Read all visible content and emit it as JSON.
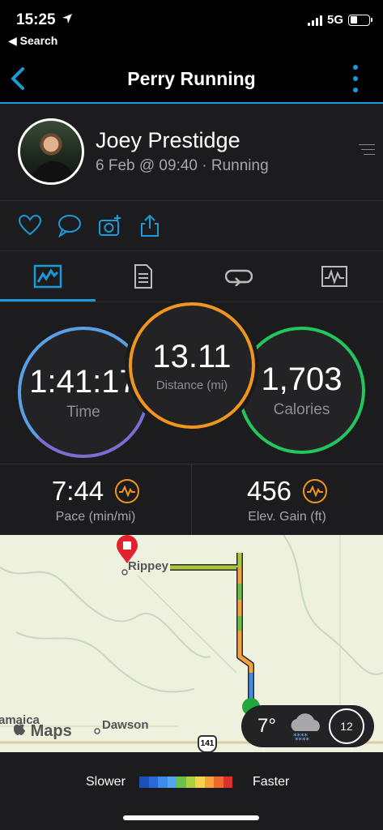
{
  "status_bar": {
    "time": "15:25",
    "back_label": "◀ Search",
    "network": "5G"
  },
  "nav": {
    "title": "Perry Running"
  },
  "header": {
    "user_name": "Joey Prestidge",
    "meta": "6 Feb @ 09:40 · Running"
  },
  "actions": [
    "heart-icon",
    "comment-icon",
    "add-photo-icon",
    "share-icon"
  ],
  "tabs": [
    "stats-tab",
    "details-tab",
    "laps-tab",
    "charts-tab"
  ],
  "stats": {
    "time": {
      "value": "1:41:17",
      "label": "Time",
      "color": "#7a6fd0"
    },
    "distance": {
      "value": "13.11",
      "label": "Distance (mi)",
      "color": "#f0951e"
    },
    "calories": {
      "value": "1,703",
      "label": "Calories",
      "color": "#22c55e"
    }
  },
  "secondary": {
    "pace": {
      "value": "7:44",
      "label": "Pace (min/mi)"
    },
    "elevation": {
      "value": "456",
      "label": "Elev. Gain (ft)"
    }
  },
  "map": {
    "labels": {
      "jamaica": "amaica",
      "dawson": "Dawson",
      "rippey": "Rippey",
      "highway": "141",
      "logo": "Maps"
    },
    "weather": {
      "temp": "7°",
      "wind": "12"
    }
  },
  "legend": {
    "slower": "Slower",
    "faster": "Faster",
    "colors": [
      "#1f4fb8",
      "#2a6ad8",
      "#3f8be8",
      "#52a6f0",
      "#6ac048",
      "#a8d040",
      "#f2d050",
      "#f3a23c",
      "#ee6a2c",
      "#d8322a"
    ]
  }
}
